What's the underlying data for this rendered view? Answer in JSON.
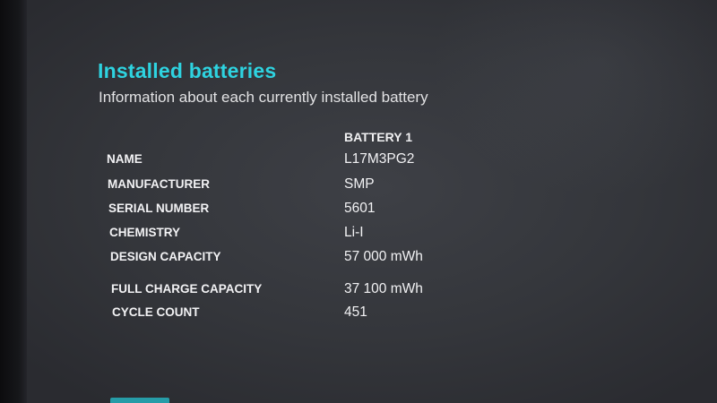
{
  "section": {
    "title": "Installed batteries",
    "subtitle": "Information about each currently installed battery"
  },
  "table": {
    "column_header": "BATTERY 1",
    "rows": [
      {
        "label": "NAME",
        "value": "L17M3PG2"
      },
      {
        "label": "MANUFACTURER",
        "value": "SMP"
      },
      {
        "label": "SERIAL NUMBER",
        "value": "5601"
      },
      {
        "label": "CHEMISTRY",
        "value": "Li-I"
      },
      {
        "label": "DESIGN CAPACITY",
        "value": "57 000 mWh"
      },
      {
        "label": "FULL CHARGE CAPACITY",
        "value": "37 100 mWh"
      },
      {
        "label": "CYCLE COUNT",
        "value": "451"
      }
    ]
  },
  "colors": {
    "heading": "#2ed3e0",
    "text": "#f2f2f4",
    "background": "#35373c"
  }
}
